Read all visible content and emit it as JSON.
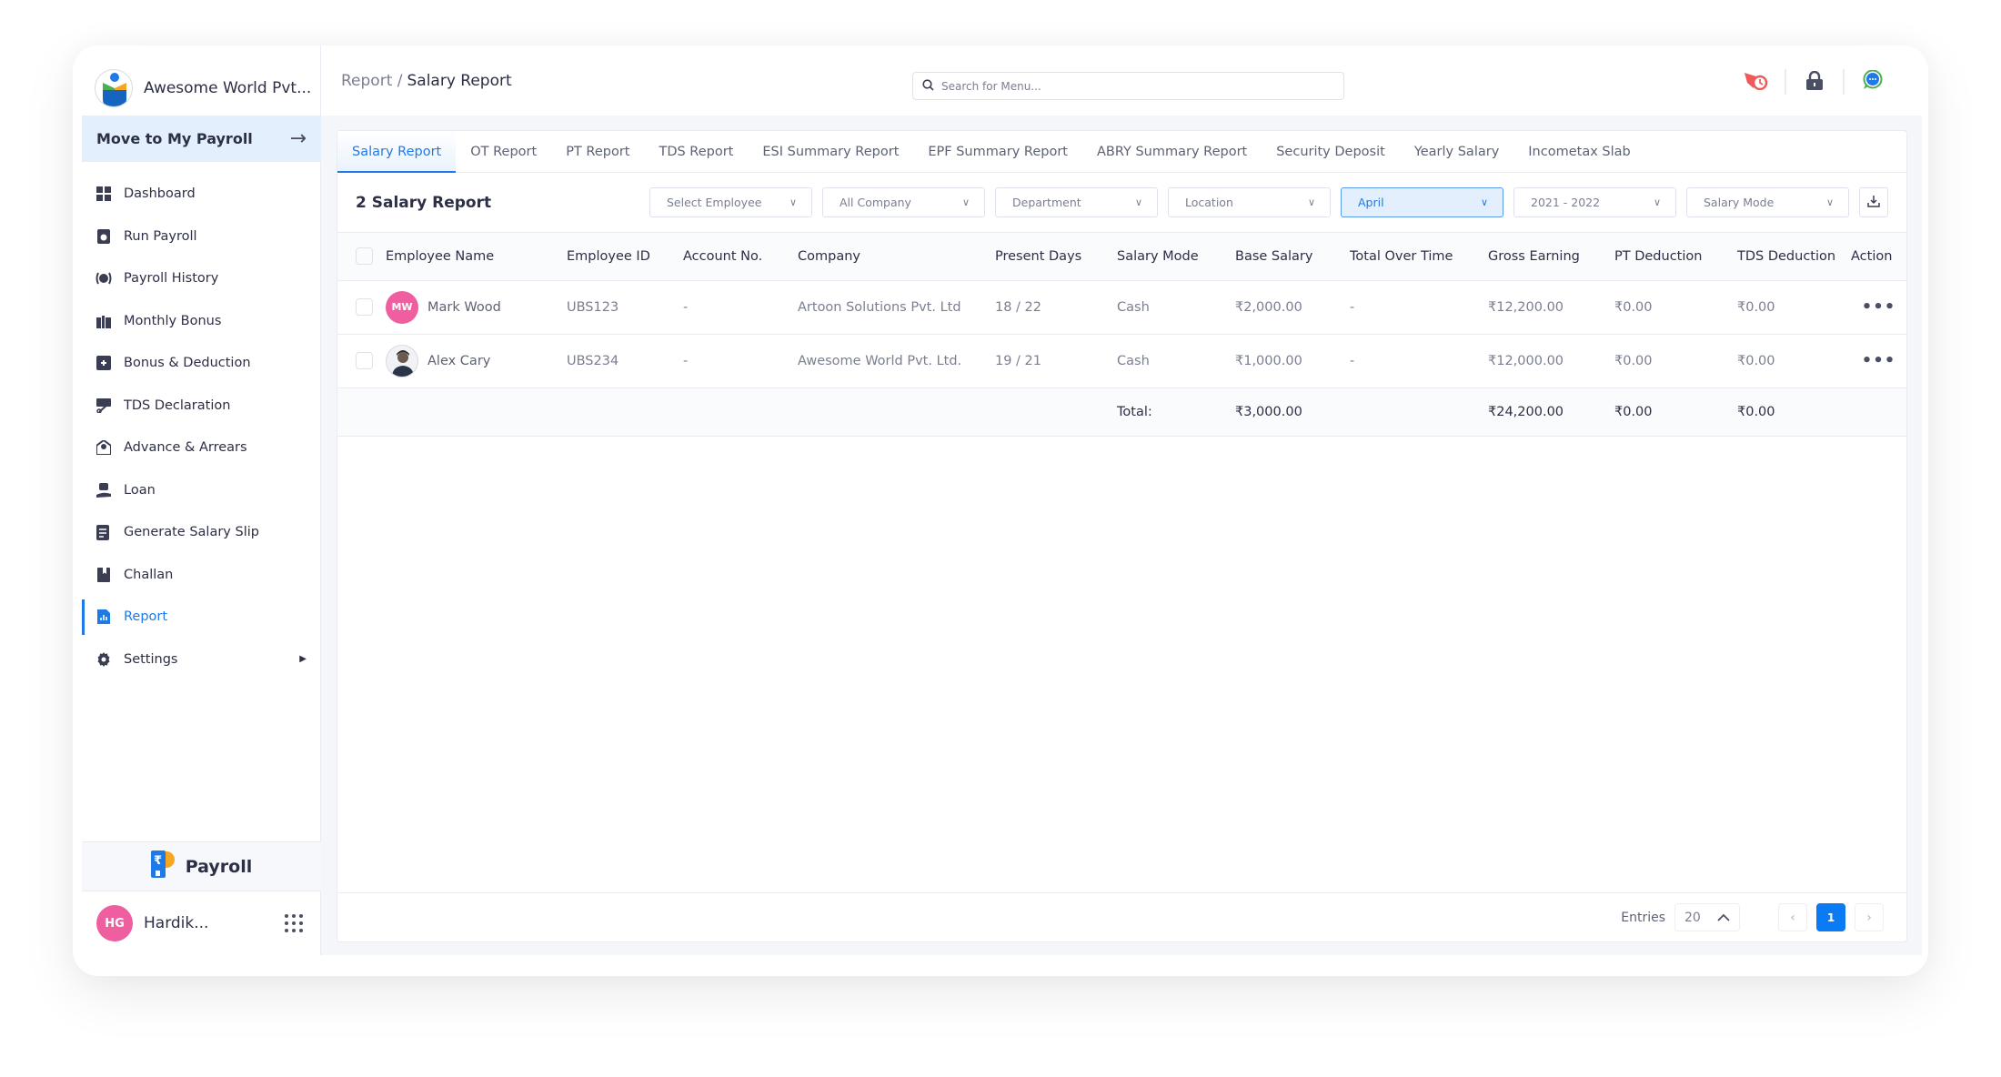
{
  "brand": {
    "name": "Awesome World Pvt..."
  },
  "move_to": {
    "label": "Move to My Payroll"
  },
  "sidebar": {
    "items": [
      {
        "label": "Dashboard",
        "icon": "dashboard-icon"
      },
      {
        "label": "Run Payroll",
        "icon": "run-payroll-icon"
      },
      {
        "label": "Payroll History",
        "icon": "history-icon"
      },
      {
        "label": "Monthly Bonus",
        "icon": "gift-icon"
      },
      {
        "label": "Bonus & Deduction",
        "icon": "bonus-deduction-icon"
      },
      {
        "label": "TDS Declaration",
        "icon": "tds-icon"
      },
      {
        "label": "Advance & Arrears",
        "icon": "advance-icon"
      },
      {
        "label": "Loan",
        "icon": "loan-icon"
      },
      {
        "label": "Generate Salary Slip",
        "icon": "salary-slip-icon"
      },
      {
        "label": "Challan",
        "icon": "bookmark-icon"
      },
      {
        "label": "Report",
        "icon": "report-icon",
        "active": true
      },
      {
        "label": "Settings",
        "icon": "gear-icon"
      }
    ],
    "footer_app": "Payroll",
    "user": {
      "initials": "HG",
      "name": "Hardik..."
    }
  },
  "header": {
    "breadcrumb_parent": "Report /",
    "breadcrumb_current": "Salary Report",
    "search_placeholder": "Search for Menu..."
  },
  "tabs": [
    "Salary Report",
    "OT Report",
    "PT Report",
    "TDS Report",
    "ESI Summary Report",
    "EPF Summary Report",
    "ABRY Summary Report",
    "Security Deposit",
    "Yearly Salary",
    "Incometax Slab"
  ],
  "toolbar": {
    "title": "2 Salary Report",
    "filters": [
      "Select Employee",
      "All Company",
      "Department",
      "Location",
      "April",
      "2021 - 2022",
      "Salary Mode"
    ]
  },
  "table": {
    "columns": [
      "Employee Name",
      "Employee ID",
      "Account No.",
      "Company",
      "Present Days",
      "Salary Mode",
      "Base Salary",
      "Total Over Time",
      "Gross Earning",
      "PT Deduction",
      "TDS Deduction",
      "Action"
    ],
    "rows": [
      {
        "initials": "MW",
        "name": "Mark Wood",
        "id": "UBS123",
        "account": "-",
        "company": "Artoon Solutions Pvt. Ltd",
        "present": "18 / 22",
        "mode": "Cash",
        "base": "₹2,000.00",
        "overtime": "-",
        "gross": "₹12,200.00",
        "pt": "₹0.00",
        "tds": "₹0.00",
        "action": "•••"
      },
      {
        "initials": "",
        "name": "Alex Cary",
        "id": "UBS234",
        "account": "-",
        "company": "Awesome World Pvt. Ltd.",
        "present": "19 / 21",
        "mode": "Cash",
        "base": "₹1,000.00",
        "overtime": "-",
        "gross": "₹12,000.00",
        "pt": "₹0.00",
        "tds": "₹0.00",
        "action": "•••"
      }
    ],
    "total": {
      "label": "Total:",
      "base": "₹3,000.00",
      "gross": "₹24,200.00",
      "pt": "₹0.00",
      "tds": "₹0.00"
    }
  },
  "pagination": {
    "entries_label": "Entries",
    "entries_value": "20",
    "current_page": "1"
  }
}
